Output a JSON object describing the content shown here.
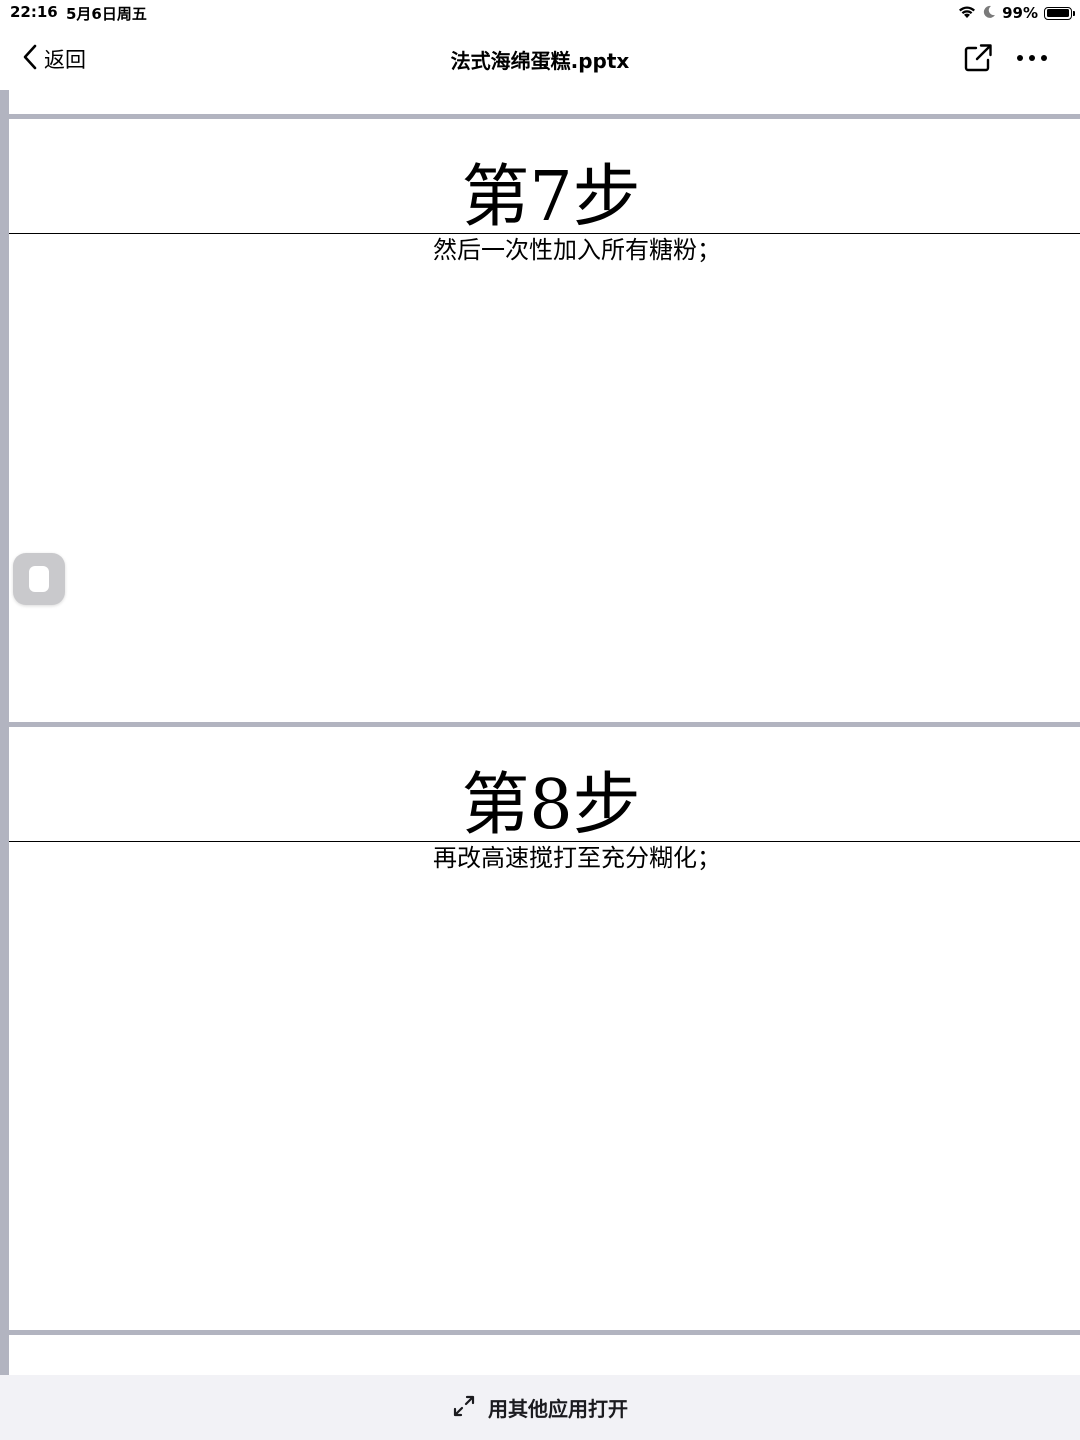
{
  "status_bar": {
    "time": "22:16",
    "date": "5月6日周五",
    "battery": "99%",
    "battery_level": 0.99,
    "icons": [
      "wifi-icon",
      "moon-icon",
      "battery-icon"
    ]
  },
  "nav": {
    "back_label": "返回",
    "title": "法式海绵蛋糕.pptx",
    "icons": [
      "chevron-left-icon",
      "share-icon",
      "more-icon"
    ]
  },
  "slides": [
    {
      "title": "第7步",
      "body": "然后一次性加入所有糖粉；"
    },
    {
      "title": "第8步",
      "body": "再改高速搅打至充分糊化；"
    }
  ],
  "bottom_bar": {
    "open_with_label": "用其他应用打开",
    "icon": "expand-icon"
  },
  "colors": {
    "slide_separator": "#b2b4c0",
    "bottom_bar_bg": "#f2f2f6"
  }
}
